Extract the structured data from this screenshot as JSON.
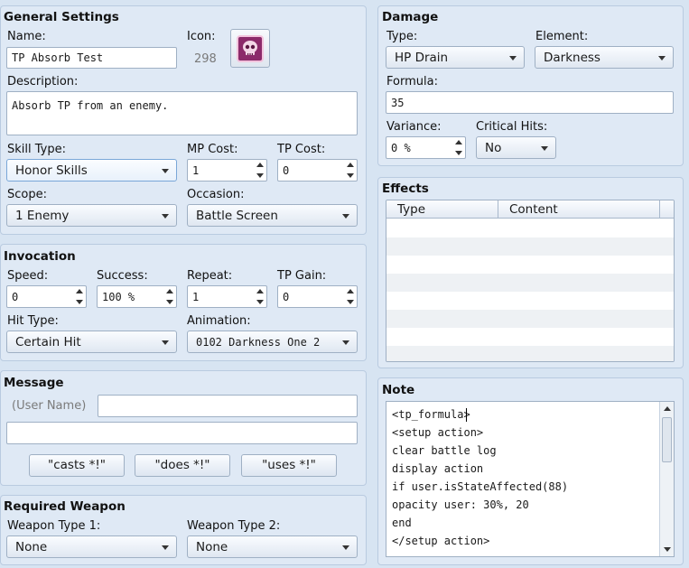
{
  "general": {
    "title": "General Settings",
    "name_label": "Name:",
    "name_value": "TP Absorb Test",
    "icon_label": "Icon:",
    "icon_index": "298",
    "icon_symbol": "☠",
    "icon_name": "skull-icon",
    "description_label": "Description:",
    "description_value": "Absorb TP from an enemy.",
    "skill_type_label": "Skill Type:",
    "skill_type_value": "Honor Skills",
    "mp_cost_label": "MP Cost:",
    "mp_cost_value": "1",
    "tp_cost_label": "TP Cost:",
    "tp_cost_value": "0",
    "scope_label": "Scope:",
    "scope_value": "1 Enemy",
    "occasion_label": "Occasion:",
    "occasion_value": "Battle Screen"
  },
  "invocation": {
    "title": "Invocation",
    "speed_label": "Speed:",
    "speed_value": "0",
    "success_label": "Success:",
    "success_value": "100 %",
    "repeat_label": "Repeat:",
    "repeat_value": "1",
    "tp_gain_label": "TP Gain:",
    "tp_gain_value": "0",
    "hit_type_label": "Hit Type:",
    "hit_type_value": "Certain Hit",
    "animation_label": "Animation:",
    "animation_value": "0102 Darkness One 2"
  },
  "message": {
    "title": "Message",
    "user_name_placeholder": "(User Name)",
    "line1": "",
    "line2": "",
    "casts_button": "\"casts *!\"",
    "does_button": "\"does *!\"",
    "uses_button": "\"uses *!\""
  },
  "required_weapon": {
    "title": "Required Weapon",
    "type1_label": "Weapon Type 1:",
    "type1_value": "None",
    "type2_label": "Weapon Type 2:",
    "type2_value": "None"
  },
  "damage": {
    "title": "Damage",
    "type_label": "Type:",
    "type_value": "HP Drain",
    "element_label": "Element:",
    "element_value": "Darkness",
    "formula_label": "Formula:",
    "formula_value": "35",
    "variance_label": "Variance:",
    "variance_value": "0 %",
    "critical_label": "Critical Hits:",
    "critical_value": "No"
  },
  "effects": {
    "title": "Effects",
    "columns": [
      "Type",
      "Content"
    ]
  },
  "note": {
    "title": "Note",
    "lines": [
      "<tp_formula>",
      "<setup action>",
      "clear battle log",
      "display action",
      "if user.isStateAffected(88)",
      "opacity user: 30%, 20",
      "end",
      "</setup action>"
    ]
  },
  "colors": {
    "background": "#d7e4f2",
    "panel": "#dfe9f5",
    "icon_fill": "#8c2a6a"
  }
}
